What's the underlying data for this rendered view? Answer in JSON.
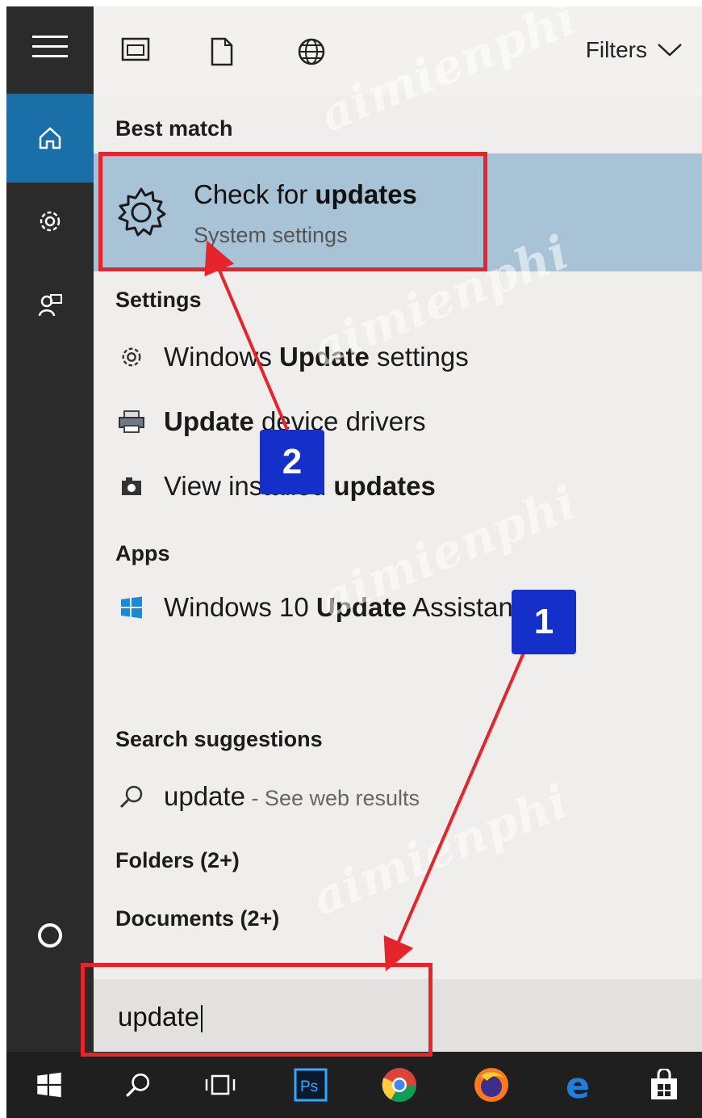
{
  "header": {
    "filters_label": "Filters"
  },
  "best_match": {
    "heading": "Best match",
    "title_plain": "Check for ",
    "title_bold": "updates",
    "subtitle": "System settings"
  },
  "settings": {
    "heading": "Settings",
    "items": [
      {
        "plain1": "Windows ",
        "bold": "Update",
        "plain2": " settings",
        "icon": "gear-icon"
      },
      {
        "plain1": "",
        "bold": "Update",
        "plain2": " device drivers",
        "icon": "printer-icon"
      },
      {
        "plain1": "View installed ",
        "bold": "updates",
        "plain2": "",
        "icon": "camera-icon"
      }
    ]
  },
  "apps": {
    "heading": "Apps",
    "items": [
      {
        "plain1": "Windows 10 ",
        "bold": "Update",
        "plain2": " Assistant",
        "icon": "windows-logo-icon"
      }
    ]
  },
  "suggestions": {
    "heading": "Search suggestions",
    "query": "update",
    "web_suffix": " - See web results"
  },
  "folders_label": "Folders (2+)",
  "documents_label": "Documents (2+)",
  "search_box": {
    "value": "update"
  },
  "annotations": {
    "badge1": "1",
    "badge2": "2",
    "color": "#e5242b",
    "badge_color": "#1530c8"
  },
  "watermark": "aimienphi",
  "colors": {
    "accent": "#1a6fa8",
    "highlight": "#a8c3d5"
  }
}
